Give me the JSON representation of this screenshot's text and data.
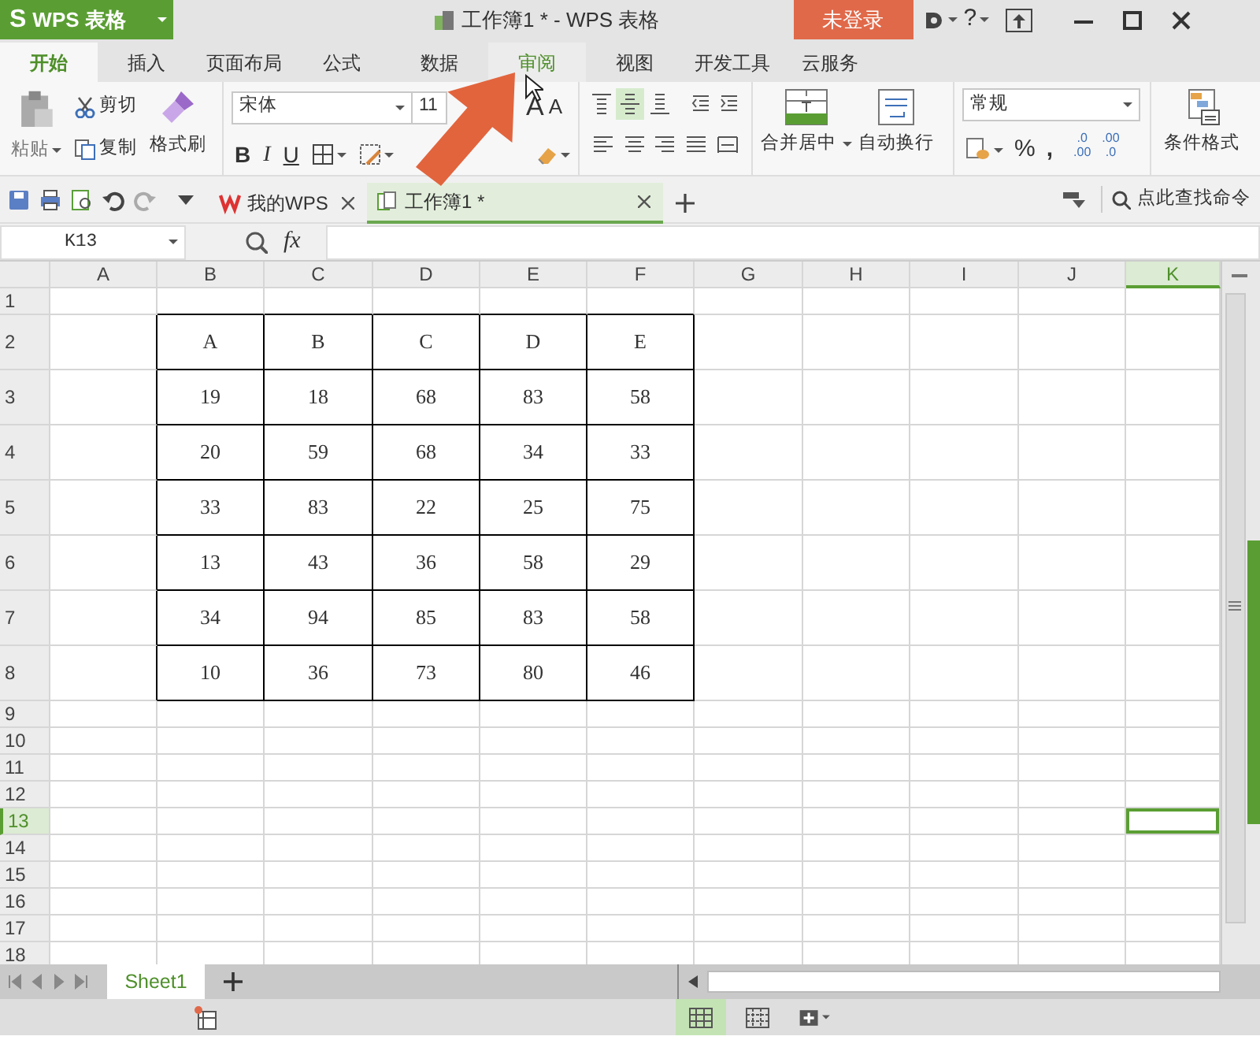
{
  "app_button": {
    "logo": "S",
    "label": "WPS 表格"
  },
  "window": {
    "title": "工作簿1 * - WPS 表格"
  },
  "login_button": {
    "label": "未登录"
  },
  "help_button": {
    "label": "?"
  },
  "ribbon_tabs": [
    {
      "label": "开始",
      "selected": true,
      "hovered": false
    },
    {
      "label": "插入",
      "selected": false,
      "hovered": false
    },
    {
      "label": "页面布局",
      "selected": false,
      "hovered": false
    },
    {
      "label": "公式",
      "selected": false,
      "hovered": false
    },
    {
      "label": "数据",
      "selected": false,
      "hovered": false
    },
    {
      "label": "审阅",
      "selected": false,
      "hovered": true
    },
    {
      "label": "视图",
      "selected": false,
      "hovered": false
    },
    {
      "label": "开发工具",
      "selected": false,
      "hovered": false
    },
    {
      "label": "云服务",
      "selected": false,
      "hovered": false
    }
  ],
  "ribbon": {
    "paste": {
      "label": "粘贴"
    },
    "cut": {
      "label": "剪切"
    },
    "copy": {
      "label": "复制"
    },
    "format_painter": {
      "label": "格式刷"
    },
    "font_name": {
      "value": "宋体"
    },
    "font_size": {
      "value": "11"
    },
    "grow_font": {
      "label": "A"
    },
    "shrink_font": {
      "label": "A"
    },
    "bold": {
      "label": "B"
    },
    "italic": {
      "label": "I"
    },
    "underline": {
      "label": "U"
    },
    "alignment": [
      {
        "kind": "top",
        "selected": false
      },
      {
        "kind": "middle",
        "selected": true
      },
      {
        "kind": "bottom",
        "selected": false
      },
      {
        "kind": "outdent",
        "selected": false
      },
      {
        "kind": "indent",
        "selected": false
      },
      {
        "kind": "left",
        "selected": false
      },
      {
        "kind": "center",
        "selected": false
      },
      {
        "kind": "right",
        "selected": false
      },
      {
        "kind": "justify",
        "selected": false
      },
      {
        "kind": "distributed",
        "selected": false
      }
    ],
    "merge_center": {
      "label": "合并居中"
    },
    "wrap_text": {
      "label": "自动换行"
    },
    "number_format": {
      "value": "常规"
    },
    "percent": {
      "label": "%"
    },
    "comma": {
      "label": ","
    },
    "decimals": [
      {
        "top": ".0",
        "bottom": ".00"
      },
      {
        "top": ".00",
        "bottom": ".0"
      }
    ],
    "conditional_format": {
      "label": "条件格式"
    }
  },
  "doc_tabs": [
    {
      "label": "我的WPS",
      "kind": "home",
      "selected": false
    },
    {
      "label": "工作簿1 *",
      "kind": "workbook",
      "selected": true
    }
  ],
  "command_search": {
    "placeholder": "点此查找命令"
  },
  "name_box": {
    "value": "K13"
  },
  "formula_bar": {
    "fx": "fx"
  },
  "columns": [
    {
      "label": "A",
      "selected": false
    },
    {
      "label": "B",
      "selected": false
    },
    {
      "label": "C",
      "selected": false
    },
    {
      "label": "D",
      "selected": false
    },
    {
      "label": "E",
      "selected": false
    },
    {
      "label": "F",
      "selected": false
    },
    {
      "label": "G",
      "selected": false
    },
    {
      "label": "H",
      "selected": false
    },
    {
      "label": "I",
      "selected": false
    },
    {
      "label": "J",
      "selected": false
    },
    {
      "label": "K",
      "selected": true
    }
  ],
  "rows": [
    {
      "label": "1",
      "selected": false
    },
    {
      "label": "2",
      "selected": false
    },
    {
      "label": "3",
      "selected": false
    },
    {
      "label": "4",
      "selected": false
    },
    {
      "label": "5",
      "selected": false
    },
    {
      "label": "6",
      "selected": false
    },
    {
      "label": "7",
      "selected": false
    },
    {
      "label": "8",
      "selected": false
    },
    {
      "label": "9",
      "selected": false
    },
    {
      "label": "10",
      "selected": false
    },
    {
      "label": "11",
      "selected": false
    },
    {
      "label": "12",
      "selected": false
    },
    {
      "label": "13",
      "selected": true
    },
    {
      "label": "14",
      "selected": false
    },
    {
      "label": "15",
      "selected": false
    },
    {
      "label": "16",
      "selected": false
    },
    {
      "label": "17",
      "selected": false
    },
    {
      "label": "18",
      "selected": false
    }
  ],
  "table": {
    "header": [
      "A",
      "B",
      "C",
      "D",
      "E"
    ],
    "rows": [
      [
        "19",
        "18",
        "68",
        "83",
        "58"
      ],
      [
        "20",
        "59",
        "68",
        "34",
        "33"
      ],
      [
        "33",
        "83",
        "22",
        "25",
        "75"
      ],
      [
        "13",
        "43",
        "36",
        "58",
        "29"
      ],
      [
        "34",
        "94",
        "85",
        "83",
        "58"
      ],
      [
        "10",
        "36",
        "73",
        "80",
        "46"
      ]
    ]
  },
  "sheet_tabs": [
    {
      "label": "Sheet1",
      "selected": true
    }
  ],
  "status_bar": {
    "views": [
      {
        "kind": "normal",
        "selected": true
      },
      {
        "kind": "page-break",
        "selected": false
      },
      {
        "kind": "layout",
        "selected": false
      }
    ]
  }
}
